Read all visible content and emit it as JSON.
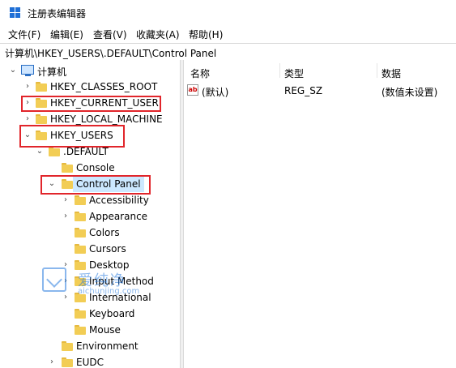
{
  "window": {
    "title": "注册表编辑器"
  },
  "menu": [
    "文件(F)",
    "编辑(E)",
    "查看(V)",
    "收藏夹(A)",
    "帮助(H)"
  ],
  "address": "计算机\\HKEY_USERS\\.DEFAULT\\Control Panel",
  "tree": {
    "root": "计算机",
    "items": [
      {
        "label": "HKEY_CLASSES_ROOT",
        "expander": "›"
      },
      {
        "label": "HKEY_CURRENT_USER",
        "expander": "›"
      },
      {
        "label": "HKEY_LOCAL_MACHINE",
        "expander": "›"
      },
      {
        "label": "HKEY_USERS",
        "expander": "⌄"
      },
      {
        "label": ".DEFAULT",
        "expander": "⌄"
      },
      {
        "label": "Console",
        "expander": ""
      },
      {
        "label": "Control Panel",
        "expander": "⌄"
      },
      {
        "label": "Accessibility",
        "expander": "›"
      },
      {
        "label": "Appearance",
        "expander": "›"
      },
      {
        "label": "Colors",
        "expander": ""
      },
      {
        "label": "Cursors",
        "expander": ""
      },
      {
        "label": "Desktop",
        "expander": "›"
      },
      {
        "label": "Input Method",
        "expander": "›"
      },
      {
        "label": "International",
        "expander": "›"
      },
      {
        "label": "Keyboard",
        "expander": ""
      },
      {
        "label": "Mouse",
        "expander": ""
      },
      {
        "label": "Environment",
        "expander": ""
      },
      {
        "label": "EUDC",
        "expander": "›"
      }
    ]
  },
  "list": {
    "headers": {
      "name": "名称",
      "type": "类型",
      "data": "数据"
    },
    "rows": [
      {
        "name": "(默认)",
        "type": "REG_SZ",
        "data": "(数值未设置)"
      }
    ]
  },
  "watermark": {
    "cn": "爱纯净",
    "en": "aichunjing.com"
  },
  "colors": {
    "highlight": "#e1252b",
    "selection": "#cce8ff",
    "folder": "#f2cd55"
  }
}
